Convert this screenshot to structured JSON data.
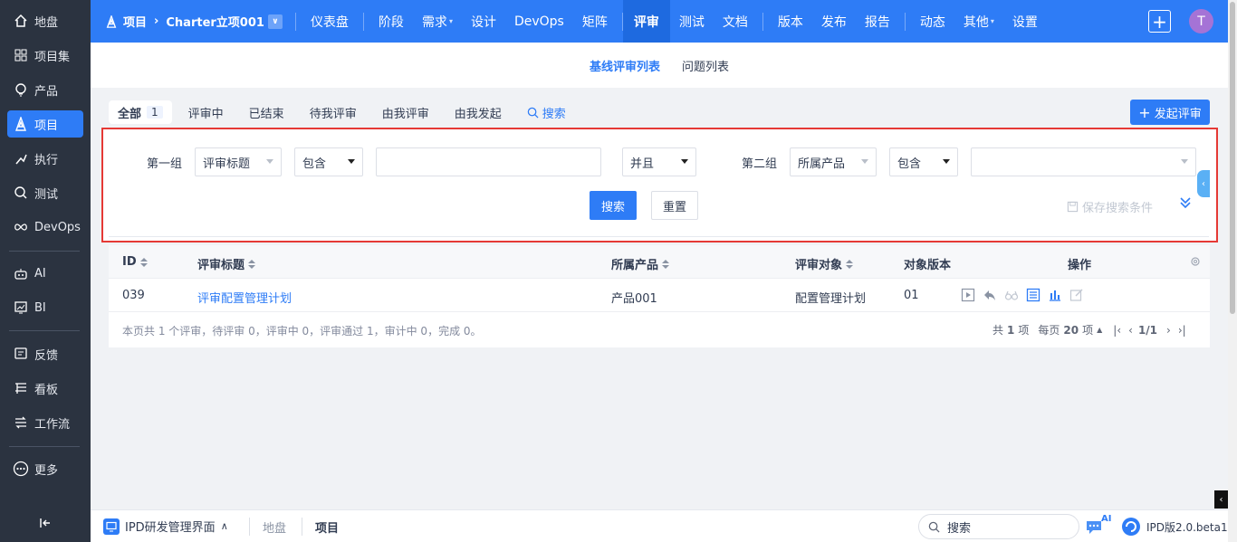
{
  "sidebar": {
    "items": [
      {
        "label": "地盘",
        "icon": "home-icon"
      },
      {
        "label": "项目集",
        "icon": "grid-icon"
      },
      {
        "label": "产品",
        "icon": "bulb-icon"
      },
      {
        "label": "项目",
        "icon": "project-icon",
        "active": true
      },
      {
        "label": "执行",
        "icon": "run-icon"
      },
      {
        "label": "测试",
        "icon": "test-icon"
      },
      {
        "label": "DevOps",
        "icon": "infinity-icon"
      },
      {
        "label": "AI",
        "icon": "robot-icon"
      },
      {
        "label": "BI",
        "icon": "chart-icon"
      },
      {
        "label": "反馈",
        "icon": "feedback-icon"
      },
      {
        "label": "看板",
        "icon": "kanban-icon"
      },
      {
        "label": "工作流",
        "icon": "workflow-icon"
      },
      {
        "label": "更多",
        "icon": "more-icon"
      }
    ],
    "collapse_icon": "collapse-icon"
  },
  "topbar": {
    "breadcrumb_root": "项目",
    "breadcrumb_project": "Charter立项001",
    "nav": [
      "仪表盘",
      "阶段",
      "需求",
      "设计",
      "DevOps",
      "矩阵",
      "评审",
      "测试",
      "文档",
      "版本",
      "发布",
      "报告",
      "动态",
      "其他",
      "设置"
    ],
    "active": "评审",
    "avatar": "T",
    "accent": "#2e7cf6"
  },
  "subnav": {
    "tab1": "基线评审列表",
    "tab2": "问题列表"
  },
  "filters": {
    "all": "全部",
    "all_count": "1",
    "in_review": "评审中",
    "finished": "已结束",
    "pending_me": "待我评审",
    "by_me": "由我评审",
    "initiated": "由我发起",
    "search": "搜索",
    "create_button": "发起评审"
  },
  "search_form": {
    "group1_label": "第一组",
    "group1_field": "评审标题",
    "group1_operator": "包含",
    "group1_value": "",
    "logic": "并且",
    "group2_label": "第二组",
    "group2_field": "所属产品",
    "group2_operator": "包含",
    "group2_value": "",
    "search_button": "搜索",
    "reset_button": "重置",
    "save_condition": "保存搜索条件"
  },
  "table": {
    "headers": {
      "id": "ID",
      "title": "评审标题",
      "product": "所属产品",
      "object": "评审对象",
      "version": "对象版本",
      "actions": "操作"
    },
    "rows": [
      {
        "id": "039",
        "title": "评审配置管理计划",
        "product": "产品001",
        "object": "配置管理计划",
        "version": "01"
      }
    ],
    "summary": "本页共 1 个评审，待评审 0，评审中 0，评审通过 1，审计中 0，完成 0。",
    "total_prefix": "共",
    "total": "1",
    "total_suffix": "项",
    "per_page_prefix": "每页",
    "per_page": "20",
    "per_page_suffix": "项",
    "page": "1/1"
  },
  "bottombar": {
    "workspace": "IPD研发管理界面",
    "crumb1": "地盘",
    "crumb2": "项目",
    "search_placeholder": "搜索",
    "ai_badge": "AI",
    "version": "IPD版2.0.beta1"
  }
}
